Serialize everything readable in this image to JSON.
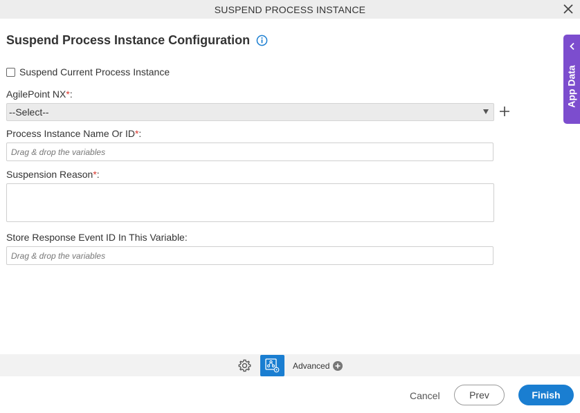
{
  "window": {
    "title": "SUSPEND PROCESS INSTANCE"
  },
  "page": {
    "heading": "Suspend Process Instance Configuration"
  },
  "form": {
    "suspend_current_label": "Suspend Current Process Instance",
    "agilepoint": {
      "label": "AgilePoint NX",
      "required_mark": "*",
      "colon": ":",
      "selected": "--Select--"
    },
    "instance": {
      "label": "Process Instance Name Or ID",
      "required_mark": "*",
      "colon": ":",
      "placeholder": "Drag & drop the variables"
    },
    "reason": {
      "label": "Suspension Reason",
      "required_mark": "*",
      "colon": ":"
    },
    "response": {
      "label": "Store Response Event ID In This Variable:",
      "placeholder": "Drag & drop the variables"
    }
  },
  "side_panel": {
    "label": "App Data"
  },
  "toolbar": {
    "advanced_label": "Advanced"
  },
  "footer": {
    "cancel": "Cancel",
    "prev": "Prev",
    "finish": "Finish"
  },
  "colors": {
    "accent": "#1a7ed1",
    "side_tab": "#7c4dce",
    "required": "#d9362c"
  },
  "icons": [
    "close-icon",
    "info-icon",
    "plus-icon",
    "chevron-left-icon",
    "gear-icon",
    "process-flow-icon",
    "add-circle-icon",
    "dropdown-caret-icon"
  ]
}
